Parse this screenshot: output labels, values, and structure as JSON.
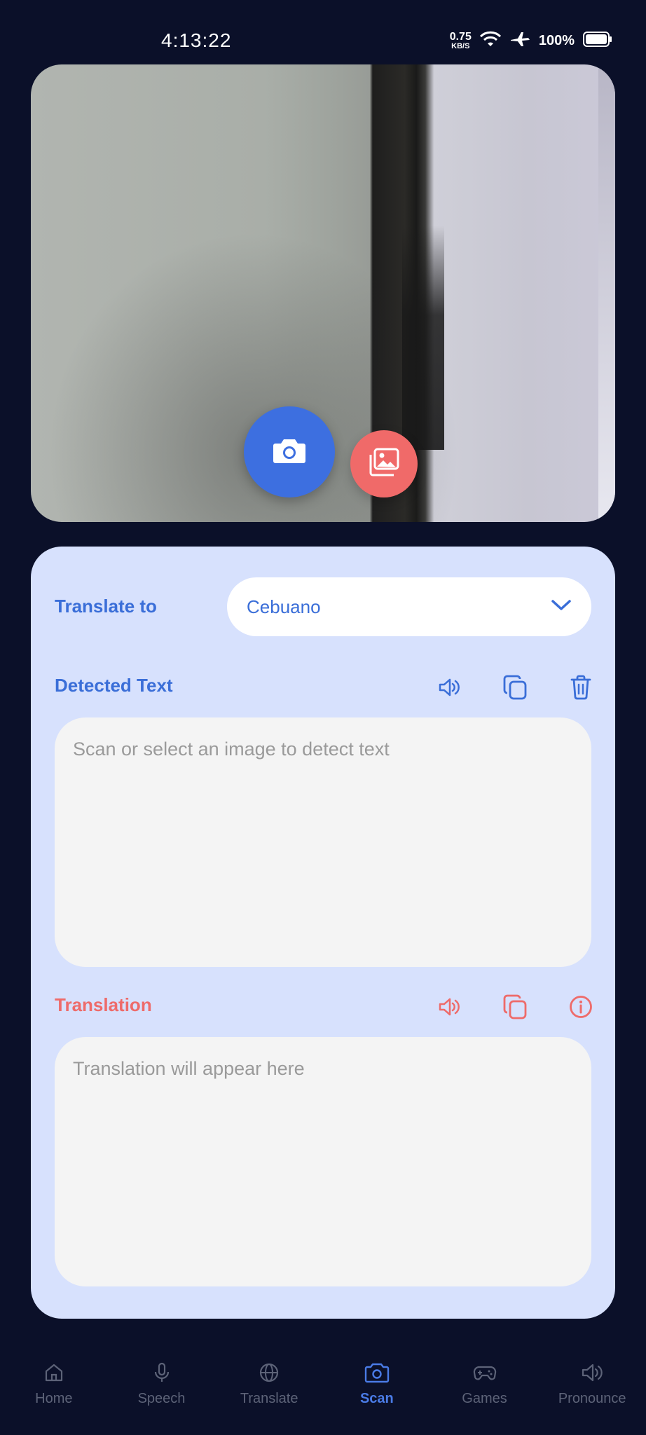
{
  "status_bar": {
    "time": "4:13:22",
    "net_speed_value": "0.75",
    "net_speed_unit": "KB/S",
    "battery": "100%"
  },
  "scanner": {
    "actions": [
      "camera-capture",
      "gallery-select"
    ]
  },
  "panel": {
    "translate_to_label": "Translate to",
    "selected_language": "Cebuano",
    "detected_label": "Detected Text",
    "detected_placeholder": "Scan or select an image to detect text",
    "translation_label": "Translation",
    "translation_placeholder": "Translation will appear here"
  },
  "nav": {
    "items": [
      {
        "label": "Home",
        "icon": "home-icon"
      },
      {
        "label": "Speech",
        "icon": "mic-icon"
      },
      {
        "label": "Translate",
        "icon": "globe-icon"
      },
      {
        "label": "Scan",
        "icon": "camera-icon",
        "active": true
      },
      {
        "label": "Games",
        "icon": "gamepad-icon"
      },
      {
        "label": "Pronounce",
        "icon": "speaker-icon"
      }
    ]
  },
  "colors": {
    "background": "#0b1029",
    "panel": "#d7e1fd",
    "primary": "#3a6ed8",
    "accent_red": "#ee6b6a",
    "capture_button": "#3d6fe0",
    "gallery_button": "#f06a69"
  }
}
